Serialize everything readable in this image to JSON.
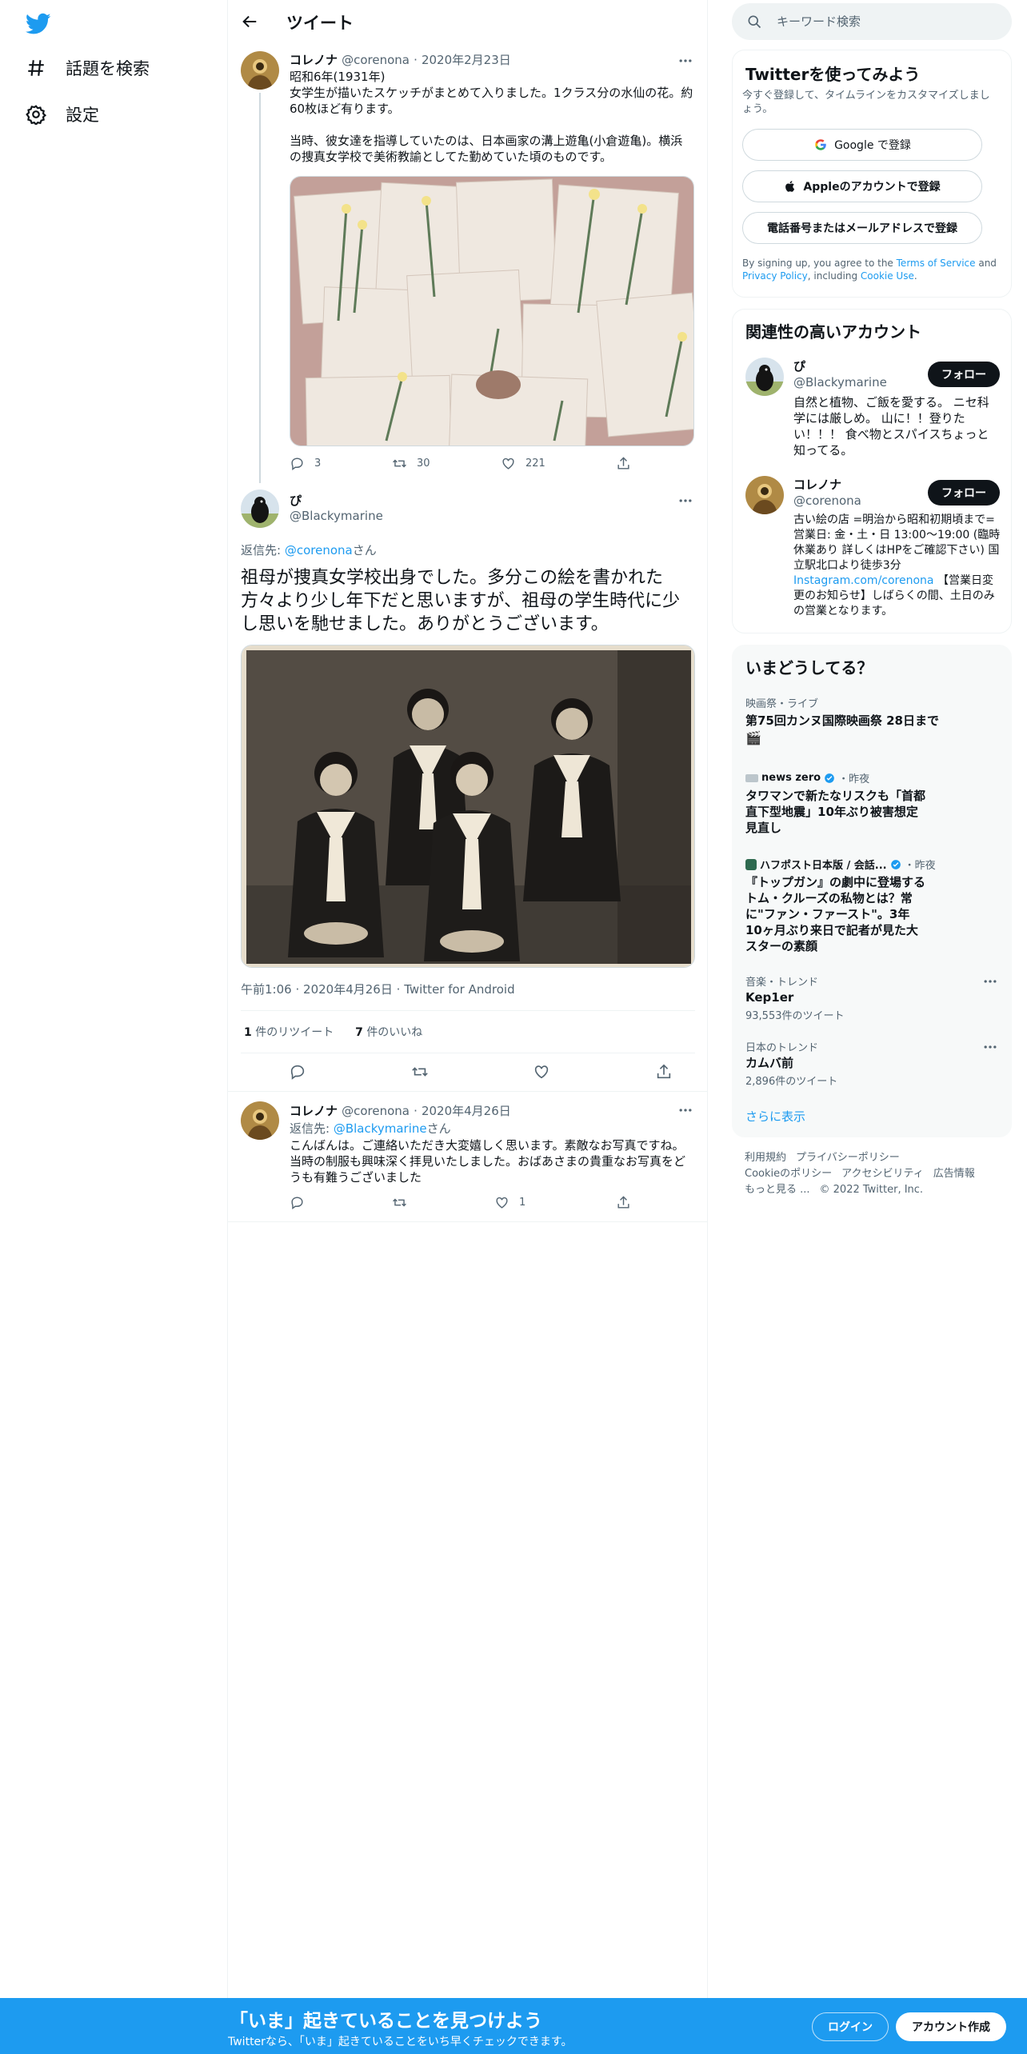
{
  "nav": {
    "explore_label": "話題を検索",
    "settings_label": "設定"
  },
  "header": {
    "title": "ツイート"
  },
  "tweets": [
    {
      "name": "コレノナ",
      "handle": "@corenona",
      "date": "2020年2月23日",
      "text": "昭和6年(1931年)\n女学生が描いたスケッチがまとめて入りました。1クラス分の水仙の花。約60枚ほど有ります。\n\n当時、彼女達を指導していたのは、日本画家の溝上遊亀(小倉遊亀)。横浜の捜真女学校で美術教諭としてた勤めていた頃のものです。",
      "replies": "3",
      "retweets": "30",
      "likes": "221"
    },
    {
      "name": "ぴ",
      "handle": "@Blackymarine",
      "reply_to_prefix": "返信先: ",
      "reply_to_handle": "@corenona",
      "reply_to_suffix": "さん",
      "text": "祖母が捜真女学校出身でした。多分この絵を書かれた方々より少し年下だと思いますが、祖母の学生時代に少し思いを馳せました。ありがとうございます。",
      "time": "午前1:06",
      "date": "2020年4月26日",
      "source": "Twitter for Android",
      "retweet_count": "1",
      "retweet_label": "件のリツイート",
      "like_count": "7",
      "like_label": "件のいいね"
    },
    {
      "name": "コレノナ",
      "handle": "@corenona",
      "date": "2020年4月26日",
      "reply_to_prefix": "返信先: ",
      "reply_to_handle": "@Blackymarine",
      "reply_to_suffix": "さん",
      "text": "こんばんは。ご連絡いただき大変嬉しく思います。素敵なお写真ですね。当時の制服も興味深く拝見いたしました。おばあさまの貴重なお写真をどうも有難うございました",
      "likes": "1"
    }
  ],
  "search": {
    "placeholder": "キーワード検索"
  },
  "signup": {
    "title": "Twitterを使ってみよう",
    "subtitle": "今すぐ登録して、タイムラインをカスタマイズしましょう。",
    "google_label": "Google で登録",
    "apple_label": "Appleのアカウントで登録",
    "phone_label": "電話番号またはメールアドレスで登録",
    "terms_prefix": "By signing up, you agree to the ",
    "terms_link": "Terms of Service",
    "terms_and": " and ",
    "privacy_link": "Privacy Policy",
    "terms_including": ", including ",
    "cookie_link": "Cookie Use",
    "terms_end": "."
  },
  "related": {
    "title": "関連性の高いアカウント",
    "follow_label": "フォロー",
    "accounts": [
      {
        "name": "ぴ",
        "handle": "@Blackymarine",
        "bio": "自然と植物、ご飯を愛する。 ニセ科学には厳しめ。 山に！！登りたい！！！ 食べ物とスパイスちょっと知ってる。"
      },
      {
        "name": "コレノナ",
        "handle": "@corenona",
        "bio": "古い絵の店 =明治から昭和初期頃まで= 営業日: 金・土・日 13:00〜19:00 (臨時休業あり 詳しくはHPをご確認下さい) 国立駅北口より徒歩3分 ",
        "bio_link": "Instagram.com/corenona",
        "bio_tail": " 【営業日変更のお知らせ】しばらくの間、土日のみの営業となります。"
      }
    ]
  },
  "trends": {
    "title": "いまどうしてる？",
    "show_more": "さらに表示",
    "items": [
      {
        "category": "映画祭・ライブ",
        "title": "第75回カンヌ国際映画祭 28日まで",
        "emoji": "🎬"
      },
      {
        "source": "news zero",
        "time": "・昨夜",
        "title": "タワマンで新たなリスクも「首都直下型地震」10年ぶり被害想定見直し"
      },
      {
        "source": "ハフポスト日本版 / 会話...",
        "time": "・昨夜",
        "title": "『トップガン』の劇中に登場するトム・クルーズの私物とは？常に\"ファン・ファースト\"。3年10ヶ月ぶり来日で記者が見た大スターの素顔"
      },
      {
        "category": "音楽・トレンド",
        "title": "Kep1er",
        "count": "93,553件のツイート"
      },
      {
        "category": "日本のトレンド",
        "title": "カムバ前",
        "count": "2,896件のツイート"
      }
    ]
  },
  "footer": {
    "terms": "利用規約",
    "privacy": "プライバシーポリシー",
    "cookie": "Cookieのポリシー",
    "accessibility": "アクセシビリティ",
    "ads": "広告情報",
    "more": "もっと見る ...",
    "copyright": "© 2022 Twitter, Inc."
  },
  "bottom_bar": {
    "title": "「いま」起きていることを見つけよう",
    "subtitle": "Twitterなら、「いま」起きていることをいち早くチェックできます。",
    "login": "ログイン",
    "signup": "アカウント作成"
  },
  "colors": {
    "accent": "#1d9bf0",
    "text": "#0f1419",
    "muted": "#536471",
    "border": "#eff3f4"
  }
}
